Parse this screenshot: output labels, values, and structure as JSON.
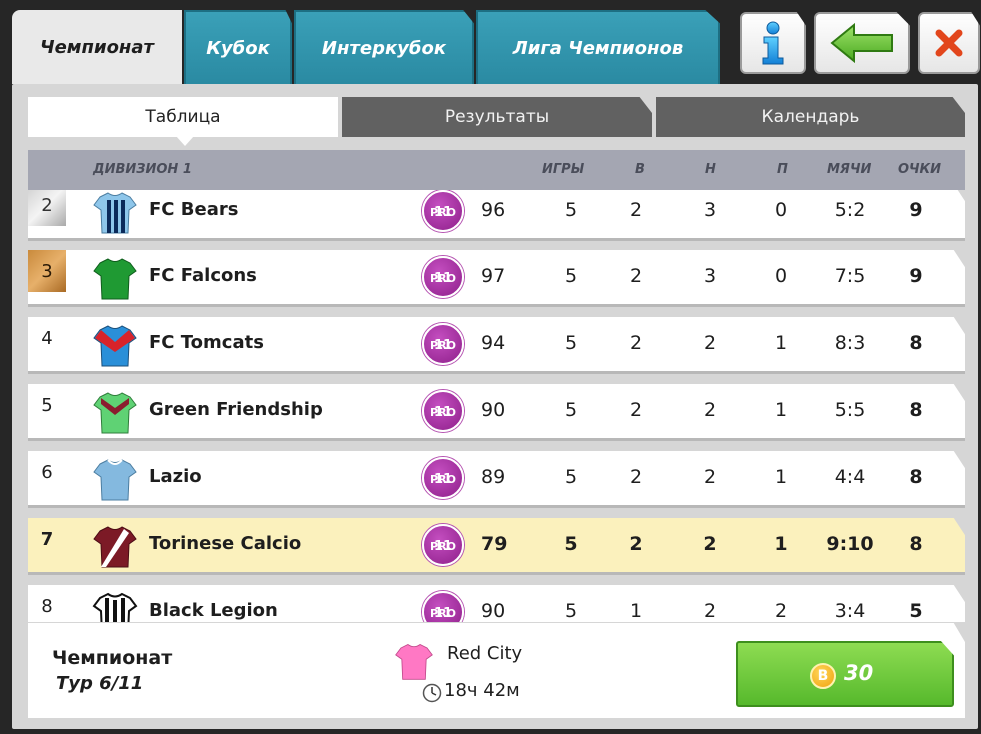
{
  "tabs": [
    {
      "label": "Чемпионат",
      "active": true
    },
    {
      "label": "Кубок",
      "active": false
    },
    {
      "label": "Интеркубок",
      "active": false
    },
    {
      "label": "Лига Чемпионов",
      "active": false
    }
  ],
  "top_buttons": {
    "info_icon": "info-icon",
    "back_icon": "back-arrow-icon",
    "close_icon": "close-icon"
  },
  "subtabs": [
    {
      "label": "Таблица",
      "active": true
    },
    {
      "label": "Результаты",
      "active": false
    },
    {
      "label": "Календарь",
      "active": false
    }
  ],
  "table": {
    "division": "ДИВИЗИОН 1",
    "columns": {
      "games": "ИГРЫ",
      "wins": "В",
      "draws": "Н",
      "losses": "П",
      "goals": "МЯЧИ",
      "points": "ОЧКИ"
    },
    "pro_badge": {
      "top": "PRO",
      "bottom": "11"
    },
    "rows": [
      {
        "pos": "2",
        "medal": "silver",
        "name": "FC Bears",
        "shirt": "stripes-blue-black",
        "rating": "96",
        "games": "5",
        "w": "2",
        "d": "3",
        "l": "0",
        "goals": "5:2",
        "pts": "9"
      },
      {
        "pos": "3",
        "medal": "bronze",
        "name": "FC Falcons",
        "shirt": "green",
        "rating": "97",
        "games": "5",
        "w": "2",
        "d": "3",
        "l": "0",
        "goals": "7:5",
        "pts": "9"
      },
      {
        "pos": "4",
        "medal": "",
        "name": "FC Tomcats",
        "shirt": "blue-red-chevron",
        "rating": "94",
        "games": "5",
        "w": "2",
        "d": "2",
        "l": "1",
        "goals": "8:3",
        "pts": "8"
      },
      {
        "pos": "5",
        "medal": "",
        "name": "Green Friendship",
        "shirt": "green-maroon-chevron",
        "rating": "90",
        "games": "5",
        "w": "2",
        "d": "2",
        "l": "1",
        "goals": "5:5",
        "pts": "8"
      },
      {
        "pos": "6",
        "medal": "",
        "name": "Lazio",
        "shirt": "sky-blue",
        "rating": "89",
        "games": "5",
        "w": "2",
        "d": "2",
        "l": "1",
        "goals": "4:4",
        "pts": "8"
      },
      {
        "pos": "7",
        "medal": "",
        "name": "Torinese Calcio",
        "shirt": "maroon-sash",
        "rating": "79",
        "games": "5",
        "w": "2",
        "d": "2",
        "l": "1",
        "goals": "9:10",
        "pts": "8",
        "highlight": true
      },
      {
        "pos": "8",
        "medal": "",
        "name": "Black Legion",
        "shirt": "black-white-stripes",
        "rating": "90",
        "games": "5",
        "w": "1",
        "d": "2",
        "l": "2",
        "goals": "3:4",
        "pts": "5"
      }
    ]
  },
  "footer": {
    "title": "Чемпионат",
    "round": "Тур 6/11",
    "opponent": "Red City",
    "time": "18ч 42м",
    "coin_symbol": "B",
    "coin_value": "30",
    "colors": {
      "button_green": "#6cc63a",
      "coin": "#f5b41c",
      "opponent_shirt": "#ff78c4"
    }
  },
  "colors": {
    "tab_blue": "#3399b3",
    "highlight_row": "#fbf1bd",
    "header_row": "#a4a6b2"
  }
}
